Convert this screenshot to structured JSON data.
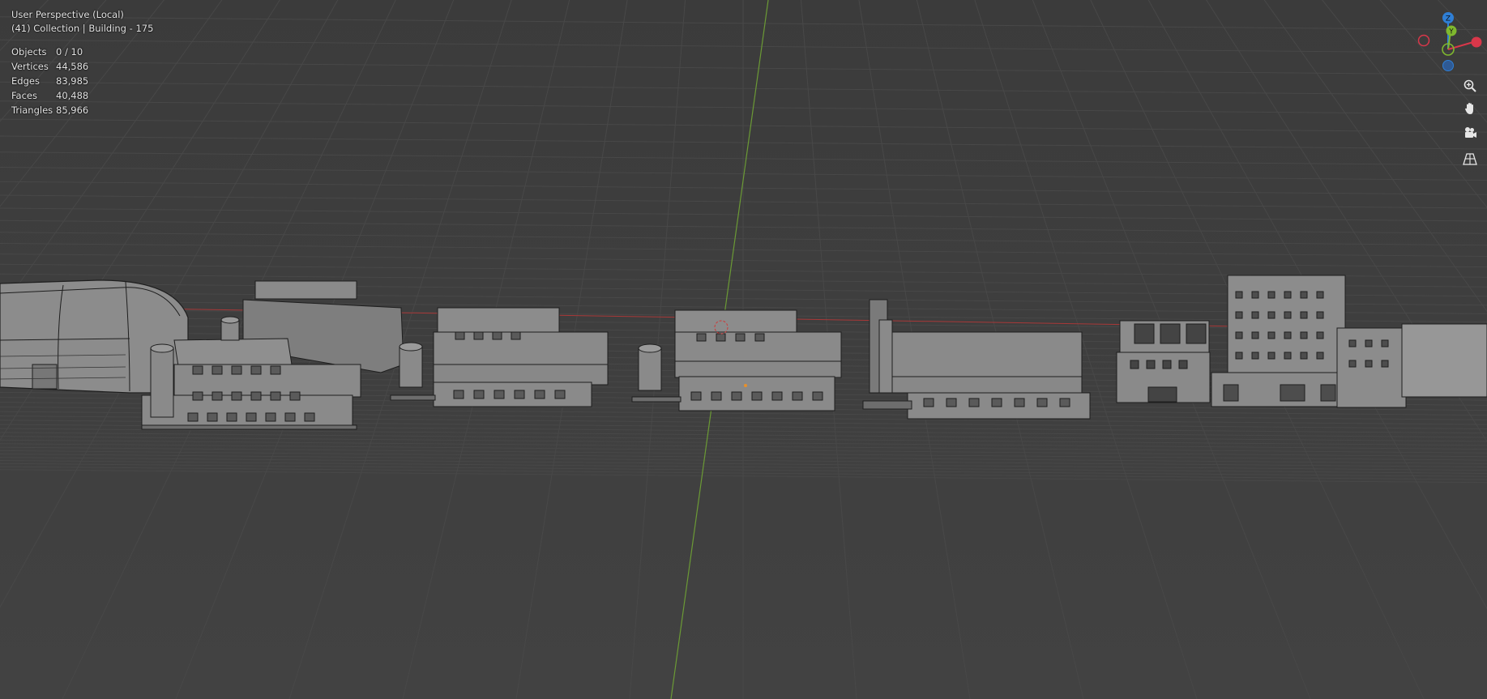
{
  "viewport": {
    "mode_title": "User Perspective (Local)",
    "context_line": "(41) Collection | Building - 175",
    "stats": [
      {
        "label": "Objects",
        "value": "0 / 10"
      },
      {
        "label": "Vertices",
        "value": "44,586"
      },
      {
        "label": "Edges",
        "value": "83,985"
      },
      {
        "label": "Faces",
        "value": "40,488"
      },
      {
        "label": "Triangles",
        "value": "85,966"
      }
    ]
  },
  "gizmo": {
    "z_label": "Z",
    "y_label": "Y",
    "colors": {
      "x": "#d9374a",
      "y": "#7fb82e",
      "z": "#2f7fd6"
    }
  },
  "nav_buttons": [
    {
      "name": "zoom-icon"
    },
    {
      "name": "pan-hand-icon"
    },
    {
      "name": "camera-icon"
    },
    {
      "name": "grid-perspective-icon"
    }
  ],
  "colors": {
    "background": "#3d3d3d",
    "grid": "#484848",
    "building": "#8a8a8a",
    "x_axis": "#b33c3c",
    "y_axis": "#6b9a35"
  }
}
